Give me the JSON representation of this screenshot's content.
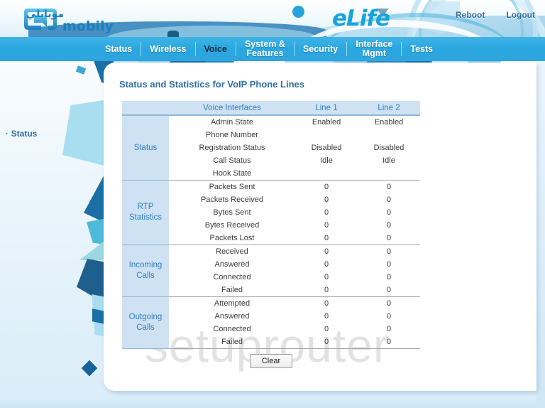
{
  "header": {
    "logo_primary_latin": "mobily",
    "logo_primary_arabic": "موبايلي",
    "logo_secondary": "eLife",
    "reboot_label": "Reboot",
    "logout_label": "Logout"
  },
  "nav": {
    "items": [
      {
        "label": "Status",
        "active": false
      },
      {
        "label": "Wireless",
        "active": false
      },
      {
        "label": "Voice",
        "active": true
      },
      {
        "label": "System &\nFeatures",
        "active": false
      },
      {
        "label": "Security",
        "active": false
      },
      {
        "label": "Interface\nMgmt",
        "active": false
      },
      {
        "label": "Tests",
        "active": false
      }
    ]
  },
  "sidebar": {
    "items": [
      {
        "bullet": "·",
        "label": "Status"
      }
    ]
  },
  "main": {
    "page_title": "Status and Statistics for VoIP Phone Lines",
    "watermark": "setuprouter",
    "clear_label": "Clear",
    "table": {
      "headers": [
        "",
        "Voice Interfaces",
        "Line 1",
        "Line 2"
      ],
      "groups": [
        {
          "name": "Status",
          "rows": [
            {
              "label": "Admin State",
              "line1": "Enabled",
              "line2": "Enabled"
            },
            {
              "label": "Phone Number",
              "line1": "",
              "line2": ""
            },
            {
              "label": "Registration Status",
              "line1": "Disabled",
              "line2": "Disabled"
            },
            {
              "label": "Call Status",
              "line1": "Idle",
              "line2": "Idle"
            },
            {
              "label": "Hook State",
              "line1": "",
              "line2": ""
            }
          ]
        },
        {
          "name": "RTP\nStatistics",
          "rows": [
            {
              "label": "Packets Sent",
              "line1": "0",
              "line2": "0"
            },
            {
              "label": "Packets Received",
              "line1": "0",
              "line2": "0"
            },
            {
              "label": "Bytes Sent",
              "line1": "0",
              "line2": "0"
            },
            {
              "label": "Bytes Received",
              "line1": "0",
              "line2": "0"
            },
            {
              "label": "Packets Lost",
              "line1": "0",
              "line2": "0"
            }
          ]
        },
        {
          "name": "Incoming\nCalls",
          "rows": [
            {
              "label": "Received",
              "line1": "0",
              "line2": "0"
            },
            {
              "label": "Answered",
              "line1": "0",
              "line2": "0"
            },
            {
              "label": "Connected",
              "line1": "0",
              "line2": "0"
            },
            {
              "label": "Failed",
              "line1": "0",
              "line2": "0"
            }
          ]
        },
        {
          "name": "Outgoing\nCalls",
          "rows": [
            {
              "label": "Attempted",
              "line1": "0",
              "line2": "0"
            },
            {
              "label": "Answered",
              "line1": "0",
              "line2": "0"
            },
            {
              "label": "Connected",
              "line1": "0",
              "line2": "0"
            },
            {
              "label": "Failed",
              "line1": "0",
              "line2": "0"
            }
          ]
        }
      ]
    }
  },
  "colors": {
    "nav_bar": "#2aa7e0",
    "accent_blue": "#2f7fc4",
    "header_link": "#3b6e95",
    "table_group_bg": "#cfe2f3",
    "elife_blue": "#17a3dd"
  }
}
